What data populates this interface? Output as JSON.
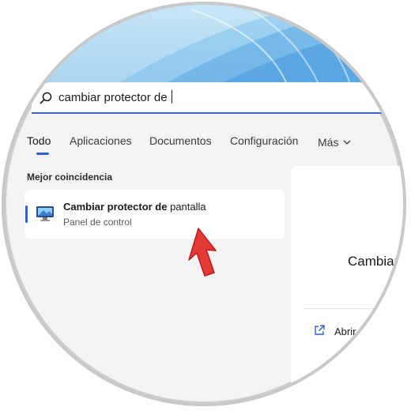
{
  "search": {
    "query": "cambiar protector de"
  },
  "tabs": [
    {
      "label": "Todo",
      "active": true
    },
    {
      "label": "Aplicaciones"
    },
    {
      "label": "Documentos"
    },
    {
      "label": "Configuración"
    },
    {
      "label": "Más"
    }
  ],
  "best_match": {
    "section_label": "Mejor coincidencia",
    "result": {
      "title_bold": "Cambiar protector de",
      "title_rest": " pantalla",
      "subtitle": "Panel de control",
      "icon": "screensaver-monitor-icon"
    }
  },
  "preview": {
    "title": "Cambiar",
    "open_label": "Abrir",
    "open_icon": "open-external-icon"
  },
  "annotation": {
    "arrow_icon": "red-pointer-arrow",
    "arrow_color": "#e53935"
  },
  "colors": {
    "accent": "#2f5fd0",
    "wallpaper": "#b6dcf3"
  }
}
